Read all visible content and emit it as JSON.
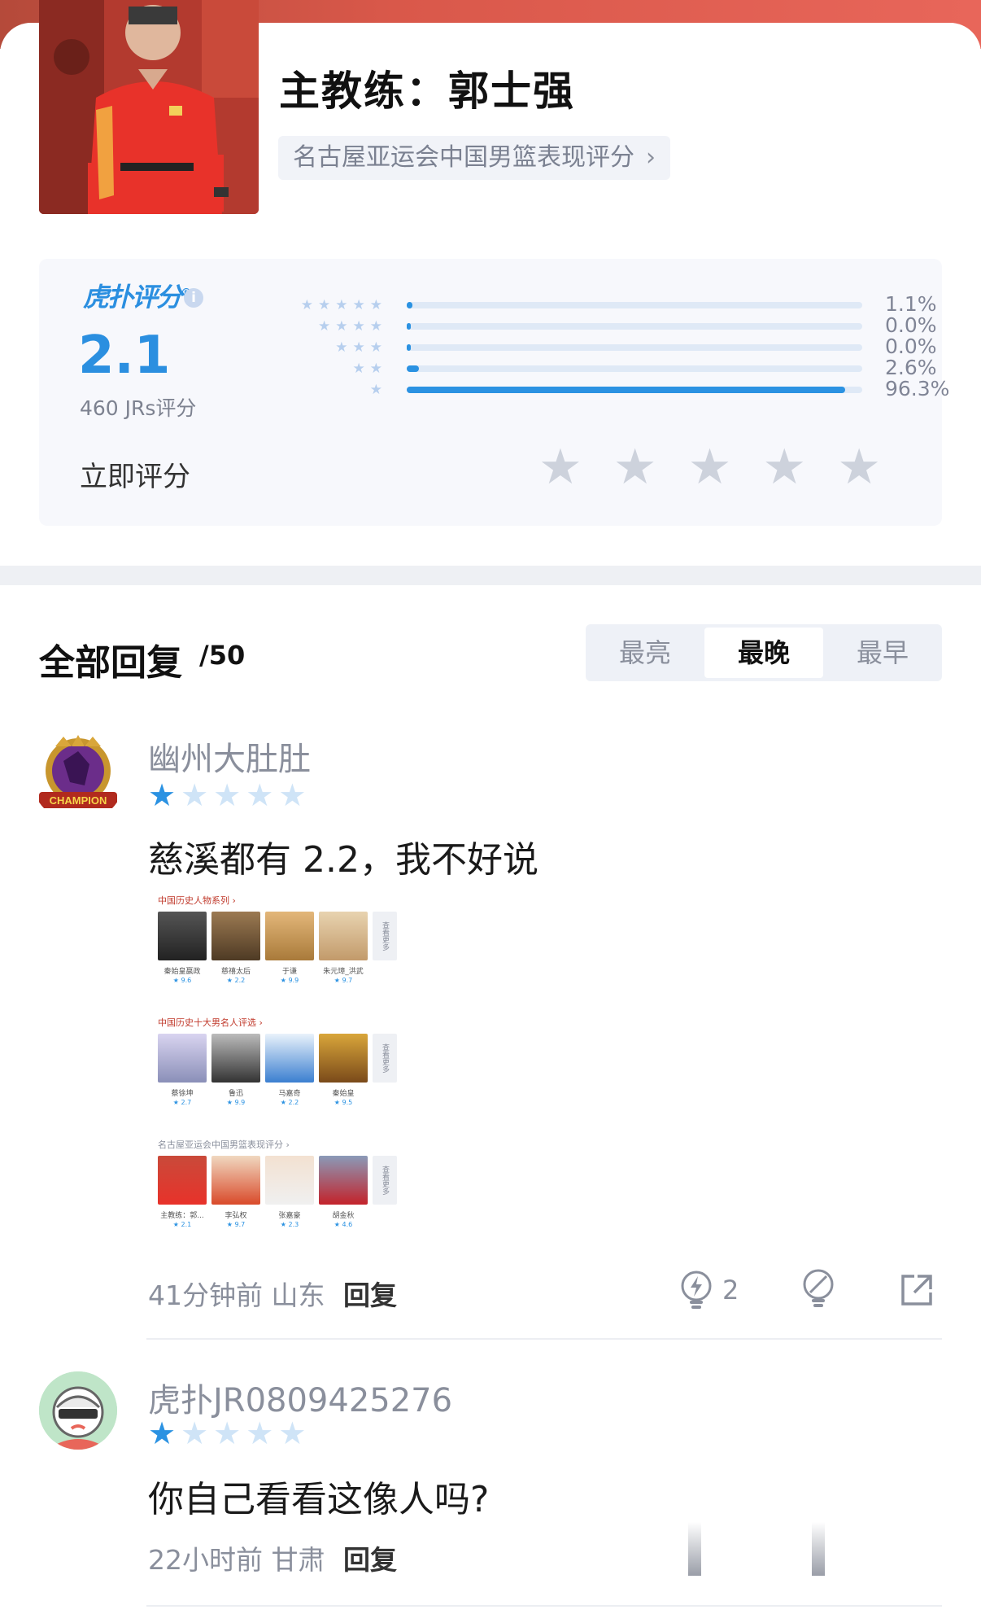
{
  "header": {
    "title": "主教练：郭士强",
    "tag_label": "名古屋亚运会中国男篮表现评分",
    "tag_chevron": "›"
  },
  "rating": {
    "brand": "虎扑评分",
    "brand_mark": "®",
    "info_icon": "i",
    "score": "2.1",
    "count_label": "460 JRs评分",
    "rate_now_label": "立即评分",
    "distribution": [
      {
        "stars": 5,
        "percent": 1.1,
        "label": "1.1%"
      },
      {
        "stars": 4,
        "percent": 0.0,
        "label": "0.0%"
      },
      {
        "stars": 3,
        "percent": 0.0,
        "label": "0.0%"
      },
      {
        "stars": 2,
        "percent": 2.6,
        "label": "2.6%"
      },
      {
        "stars": 1,
        "percent": 96.3,
        "label": "96.3%"
      }
    ],
    "accent_color": "#2b92e2"
  },
  "replies": {
    "title": "全部回复",
    "count": "/50",
    "sort_tabs": [
      {
        "label": "最亮",
        "active": false
      },
      {
        "label": "最晚",
        "active": true
      },
      {
        "label": "最早",
        "active": false
      }
    ],
    "items": [
      {
        "username": "幽州大肚肚",
        "rating_stars": 1,
        "text": "慈溪都有 2.2，我不好说",
        "time": "41分钟前",
        "location": "山东",
        "reply_label": "回复",
        "light_count": "2",
        "embedded": {
          "sections": [
            {
              "title": "中国历史人物系列 ›",
              "people": [
                {
                  "name": "秦始皇嬴政",
                  "score": "★ 9.6"
                },
                {
                  "name": "慈禧太后",
                  "score": "★ 2.2"
                },
                {
                  "name": "于谦",
                  "score": "★ 9.9"
                },
                {
                  "name": "朱元璋_洪武",
                  "score": "★ 9.7"
                }
              ],
              "more": "查看更多"
            },
            {
              "title": "中国历史十大男名人评选 ›",
              "people": [
                {
                  "name": "蔡徐坤",
                  "score": "★ 2.7"
                },
                {
                  "name": "鲁迅",
                  "score": "★ 9.9"
                },
                {
                  "name": "马嘉奇",
                  "score": "★ 2.2"
                },
                {
                  "name": "秦始皇",
                  "score": "★ 9.5"
                }
              ],
              "more": "查看更多"
            },
            {
              "title": "名古屋亚运会中国男篮表现评分 ›",
              "people": [
                {
                  "name": "主教练：郭...",
                  "score": "★ 2.1"
                },
                {
                  "name": "李弘权",
                  "score": "★ 9.7"
                },
                {
                  "name": "张嘉豪",
                  "score": "★ 2.3"
                },
                {
                  "name": "胡金秋",
                  "score": "★ 4.6"
                }
              ],
              "more": "查看更多"
            }
          ]
        }
      },
      {
        "username": "虎扑JR0809425276",
        "rating_stars": 1,
        "text": "你自己看看这像人吗?",
        "time": "22小时前",
        "location": "甘肃",
        "reply_label": "回复"
      }
    ]
  },
  "icons": {
    "light": "lightbulb-icon",
    "dislike": "dim-light-icon",
    "share": "share-icon"
  }
}
